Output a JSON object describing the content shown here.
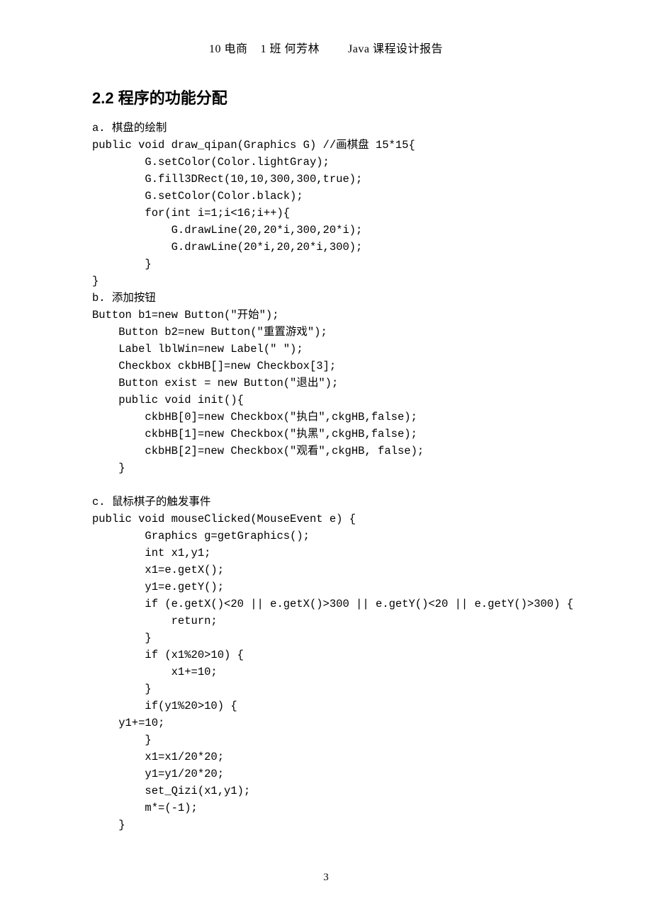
{
  "header": {
    "left": "10 电商",
    "mid": "1 班 何芳林",
    "right": "Java 课程设计报告"
  },
  "section_heading": "2.2 程序的功能分配",
  "body_lines": [
    "a. 棋盘的绘制",
    "public void draw_qipan(Graphics G) //画棋盘 15*15{",
    "        G.setColor(Color.lightGray);",
    "        G.fill3DRect(10,10,300,300,true);",
    "        G.setColor(Color.black);",
    "        for(int i=1;i<16;i++){",
    "            G.drawLine(20,20*i,300,20*i);",
    "            G.drawLine(20*i,20,20*i,300);",
    "        }",
    "}",
    "b. 添加按钮",
    "Button b1=new Button(\"开始\");",
    "    Button b2=new Button(\"重置游戏\");",
    "    Label lblWin=new Label(\" \");",
    "    Checkbox ckbHB[]=new Checkbox[3];",
    "    Button exist = new Button(\"退出\");",
    "    public void init(){",
    "        ckbHB[0]=new Checkbox(\"执白\",ckgHB,false);",
    "        ckbHB[1]=new Checkbox(\"执黑\",ckgHB,false);",
    "        ckbHB[2]=new Checkbox(\"观看\",ckgHB, false);",
    "    }",
    "",
    "c. 鼠标棋子的触发事件",
    "public void mouseClicked(MouseEvent e) {",
    "        Graphics g=getGraphics();",
    "        int x1,y1;",
    "        x1=e.getX();",
    "        y1=e.getY();",
    "        if (e.getX()<20 || e.getX()>300 || e.getY()<20 || e.getY()>300) {",
    "            return;",
    "        }",
    "        if (x1%20>10) {",
    "            x1+=10;",
    "        }",
    "        if(y1%20>10) {",
    "    y1+=10;",
    "        }",
    "        x1=x1/20*20;",
    "        y1=y1/20*20;",
    "        set_Qizi(x1,y1);",
    "        m*=(-1);",
    "    }"
  ],
  "page_number": "3"
}
